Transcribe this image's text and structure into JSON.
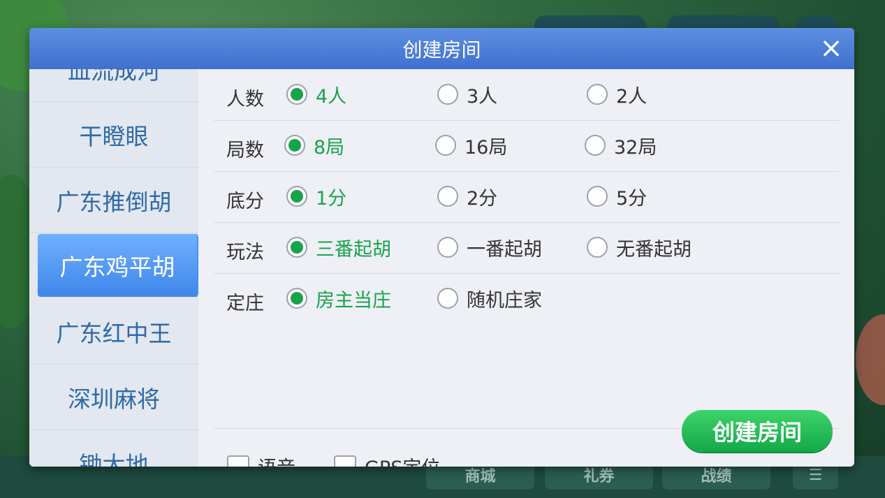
{
  "dialog": {
    "title": "创建房间",
    "close_icon": "×"
  },
  "sidebar": {
    "items": [
      {
        "label": "血流成河",
        "active": false
      },
      {
        "label": "干瞪眼",
        "active": false
      },
      {
        "label": "广东推倒胡",
        "active": false
      },
      {
        "label": "广东鸡平胡",
        "active": true
      },
      {
        "label": "广东红中王",
        "active": false
      },
      {
        "label": "深圳麻将",
        "active": false
      },
      {
        "label": "锄大地",
        "active": false
      }
    ]
  },
  "options": [
    {
      "label": "人数",
      "choices": [
        "4人",
        "3人",
        "2人"
      ],
      "selected": 0
    },
    {
      "label": "局数",
      "choices": [
        "8局",
        "16局",
        "32局"
      ],
      "selected": 0
    },
    {
      "label": "底分",
      "choices": [
        "1分",
        "2分",
        "5分"
      ],
      "selected": 0
    },
    {
      "label": "玩法",
      "choices": [
        "三番起胡",
        "一番起胡",
        "无番起胡"
      ],
      "selected": 0
    },
    {
      "label": "定庄",
      "choices": [
        "房主当庄",
        "随机庄家"
      ],
      "selected": 0
    }
  ],
  "footer": {
    "voice_label": "语音",
    "gps_label": "GPS定位",
    "voice_checked": false,
    "gps_checked": false,
    "create_button": "创建房间"
  },
  "background": {
    "bottom_items": [
      "商城",
      "礼券",
      "战绩"
    ]
  },
  "colors": {
    "header": "#4a7fd9",
    "accent_green": "#17a34a",
    "sidebar_text": "#2f6ba6",
    "sidebar_active": "#4a90ee"
  }
}
